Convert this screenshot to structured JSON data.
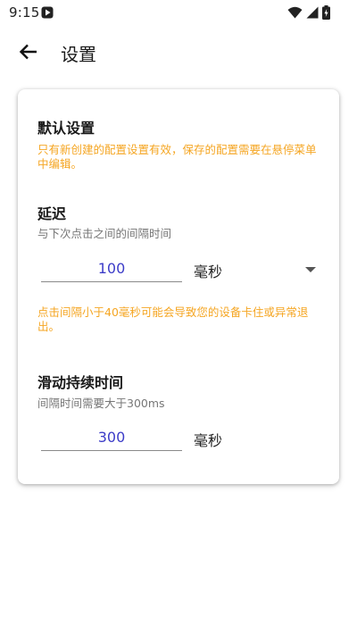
{
  "status_bar": {
    "time": "9:15",
    "icons": [
      "app-notification-icon",
      "wifi-icon",
      "signal-icon",
      "battery-icon"
    ]
  },
  "app_bar": {
    "back_icon": "arrow-left-icon",
    "title": "设置"
  },
  "card": {
    "default_section": {
      "title": "默认设置",
      "note": "只有新创建的配置设置有效，保存的配置需要在悬停菜单中编辑。"
    },
    "delay_section": {
      "title": "延迟",
      "subtitle": "与下次点击之间的间隔时间",
      "value": "100",
      "unit": "毫秒",
      "warning": "点击间隔小于40毫秒可能会导致您的设备卡住或异常退出。"
    },
    "swipe_section": {
      "title": "滑动持续时间",
      "subtitle": "间隔时间需要大于300ms",
      "value": "300",
      "unit": "毫秒"
    }
  },
  "colors": {
    "warning": "#f5a623",
    "input_value": "#3c3cc8"
  }
}
